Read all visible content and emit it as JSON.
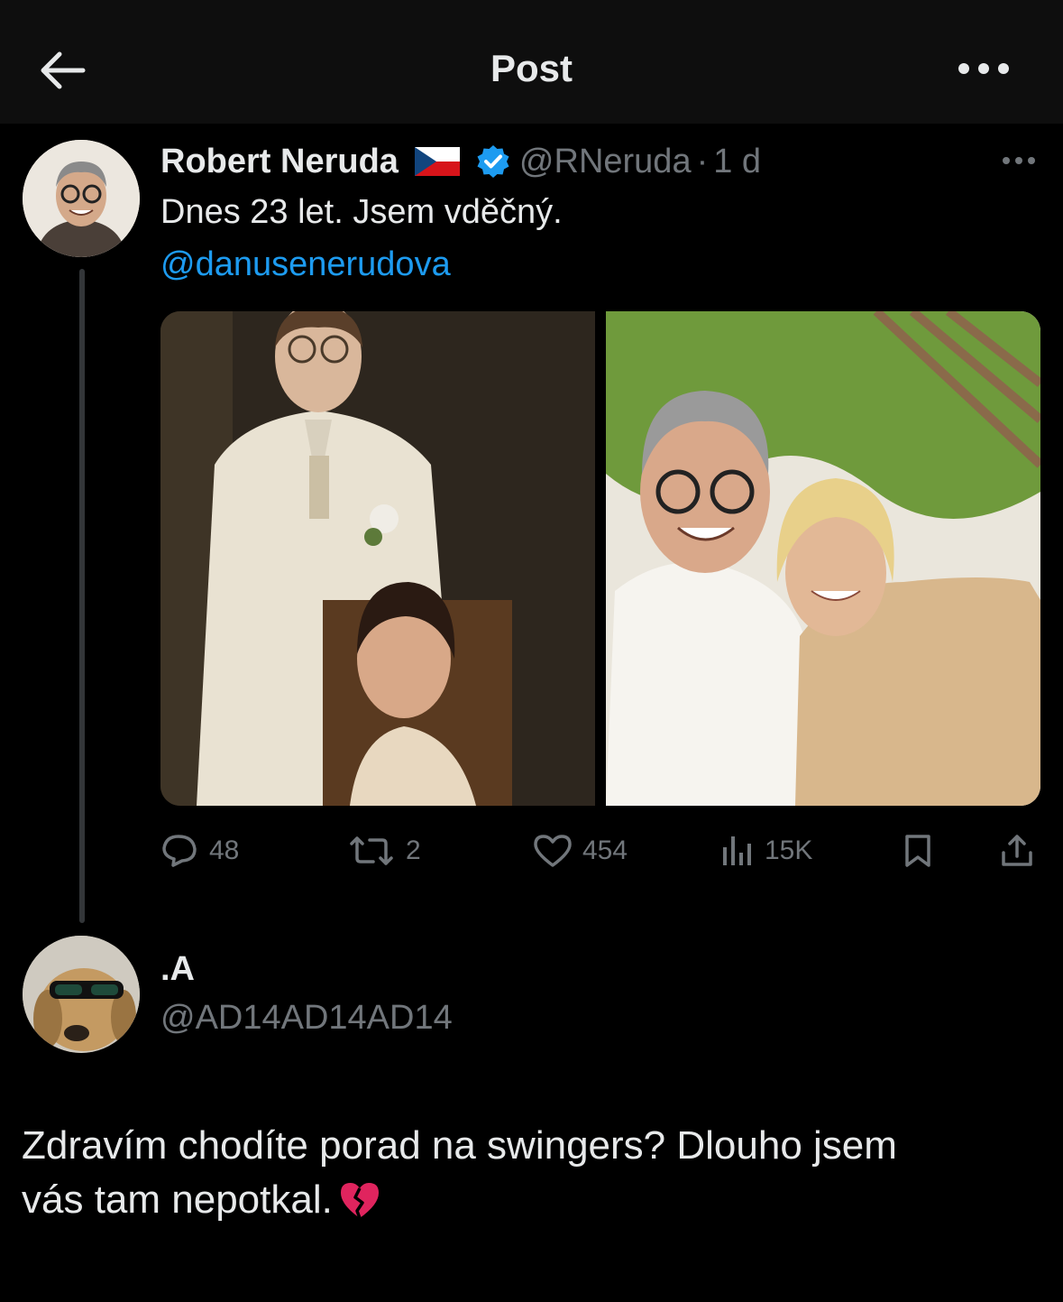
{
  "header": {
    "title": "Post",
    "back_icon": "arrow-left-icon",
    "more_icon": "more-horizontal-icon"
  },
  "tweet": {
    "author_name": "Robert Neruda",
    "flag": "czech-flag",
    "verified": true,
    "handle": "@RNeruda",
    "separator": "·",
    "time": "1 d",
    "text": "Dnes 23 let. Jsem vděčný.",
    "mention": "@danusenerudova",
    "media_count": 2,
    "stats": {
      "replies": "48",
      "reposts": "2",
      "likes": "454",
      "views": "15K"
    }
  },
  "reply": {
    "author_name": ".A",
    "handle": "@AD14AD14AD14",
    "text_line1": "Zdravím chodíte porad na swingers? Dlouho jsem",
    "text_line2": "vás tam nepotkal.",
    "emoji": "broken-heart"
  },
  "colors": {
    "background": "#000000",
    "header_bg": "#0e0e0e",
    "text_primary": "#e7e9ea",
    "text_secondary": "#71767b",
    "link": "#1d9bf0",
    "verified": "#1d9bf0"
  }
}
